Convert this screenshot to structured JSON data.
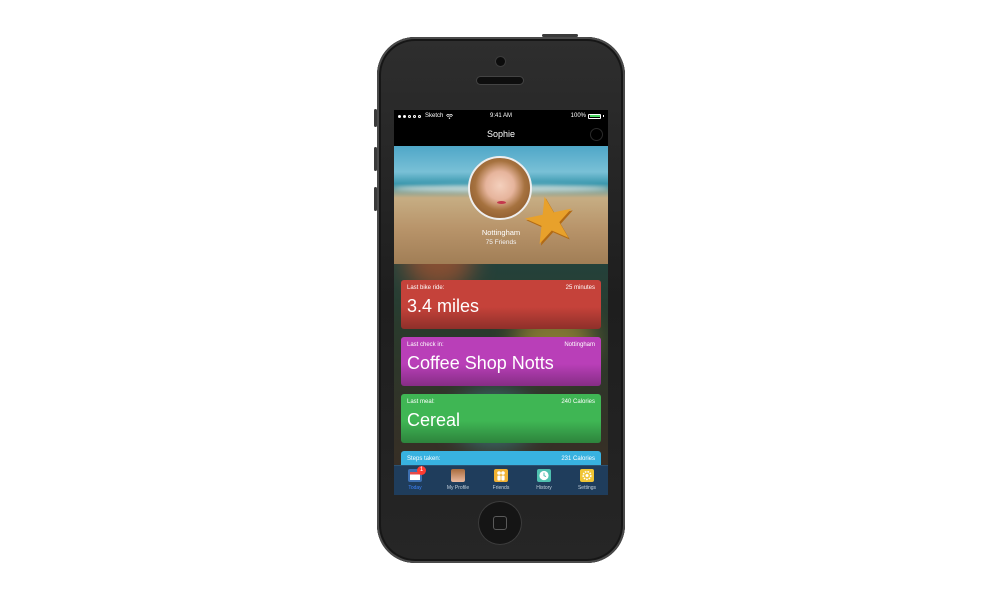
{
  "statusbar": {
    "carrier": "Sketch",
    "time": "9:41 AM",
    "battery": "100%",
    "battery_level": 1.0
  },
  "navbar": {
    "title": "Sophie"
  },
  "profile": {
    "city": "Nottingham",
    "friends": "75 Friends"
  },
  "cards": [
    {
      "label": "Last bike ride:",
      "meta": "25 minutes",
      "value": "3.4 miles",
      "color": "#c5423a"
    },
    {
      "label": "Last check in:",
      "meta": "Nottingham",
      "value": "Coffee Shop Notts",
      "color": "#b93fb8"
    },
    {
      "label": "Last meal:",
      "meta": "240 Calories",
      "value": "Cereal",
      "color": "#3fb654"
    },
    {
      "label": "Steps taken:",
      "meta": "231 Calories",
      "value": "",
      "color": "#38b2e0"
    }
  ],
  "tabs": [
    {
      "label": "Today",
      "icon": "calendar-icon",
      "badge": "1"
    },
    {
      "label": "My Profile",
      "icon": "profile-photo-icon"
    },
    {
      "label": "Friends",
      "icon": "people-icon"
    },
    {
      "label": "History",
      "icon": "clock-icon"
    },
    {
      "label": "Settings",
      "icon": "gear-icon"
    }
  ]
}
